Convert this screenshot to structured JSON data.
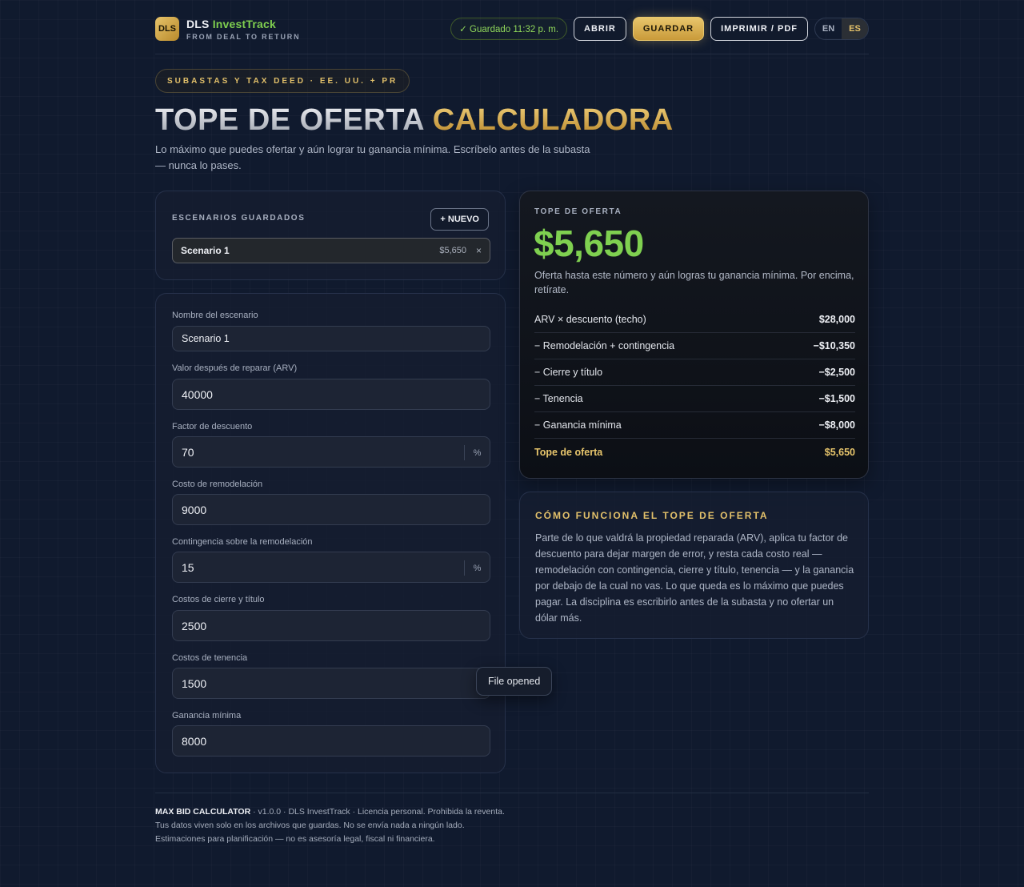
{
  "header": {
    "logo": "DLS",
    "brand_main": "DLS ",
    "brand_accent": "InvestTrack",
    "tagline": "FROM DEAL TO RETURN",
    "saved_status": "✓ Guardado 11:32 p. m.",
    "open_label": "ABRIR",
    "save_label": "GUARDAR",
    "print_label": "IMPRIMIR / PDF",
    "lang_en": "EN",
    "lang_es": "ES",
    "active_lang": "ES"
  },
  "hero": {
    "eyebrow": "SUBASTAS Y TAX DEED · EE. UU. + PR",
    "title_part1": "TOPE DE OFERTA ",
    "title_part2": "CALCULADORA",
    "subtitle": "Lo máximo que puedes ofertar y aún lograr tu ganancia mínima. Escríbelo antes de la subasta — nunca lo pases."
  },
  "scenarios": {
    "label": "ESCENARIOS GUARDADOS",
    "new_label": "+ NUEVO",
    "items": [
      {
        "name": "Scenario 1",
        "value": "$5,650",
        "remove": "×"
      }
    ]
  },
  "form": {
    "name_label": "Nombre del escenario",
    "name_value": "Scenario 1",
    "arv_label": "Valor después de reparar (ARV)",
    "arv_value": "40000",
    "discount_label": "Factor de descuento",
    "discount_value": "70",
    "discount_unit": "%",
    "rehab_label": "Costo de remodelación",
    "rehab_value": "9000",
    "contingency_label": "Contingencia sobre la remodelación",
    "contingency_value": "15",
    "contingency_unit": "%",
    "closing_label": "Costos de cierre y título",
    "closing_value": "2500",
    "holding_label": "Costos de tenencia",
    "holding_value": "1500",
    "profit_label": "Ganancia mínima",
    "profit_value": "8000"
  },
  "result": {
    "label": "TOPE DE OFERTA",
    "amount": "$5,650",
    "note": "Oferta hasta este número y aún logras tu ganancia mínima. Por encima, retírate.",
    "rows": [
      {
        "label": "ARV × descuento (techo)",
        "value": "$28,000"
      },
      {
        "label": "− Remodelación + contingencia",
        "value": "−$10,350"
      },
      {
        "label": "− Cierre y título",
        "value": "−$2,500"
      },
      {
        "label": "− Tenencia",
        "value": "−$1,500"
      },
      {
        "label": "− Ganancia mínima",
        "value": "−$8,000"
      },
      {
        "label": "Tope de oferta",
        "value": "$5,650"
      }
    ]
  },
  "how": {
    "title": "CÓMO FUNCIONA EL TOPE DE OFERTA",
    "body": "Parte de lo que valdrá la propiedad reparada (ARV), aplica tu factor de descuento para dejar margen de error, y resta cada costo real — remodelación con contingencia, cierre y título, tenencia — y la ganancia por debajo de la cual no vas. Lo que queda es lo máximo que puedes pagar. La disciplina es escribirlo antes de la subasta y no ofertar un dólar más."
  },
  "toast": "File opened",
  "footer": {
    "product": "MAX BID CALCULATOR",
    "line1_rest": " · v1.0.0 · DLS InvestTrack · Licencia personal. Prohibida la reventa.",
    "line2": "Tus datos viven solo en los archivos que guardas. No se envía nada a ningún lado.",
    "line3": "Estimaciones para planificación — no es asesoría legal, fiscal ni financiera."
  },
  "colors": {
    "gold": "#e8c66c",
    "green": "#7fd050",
    "background": "#101a2e"
  }
}
